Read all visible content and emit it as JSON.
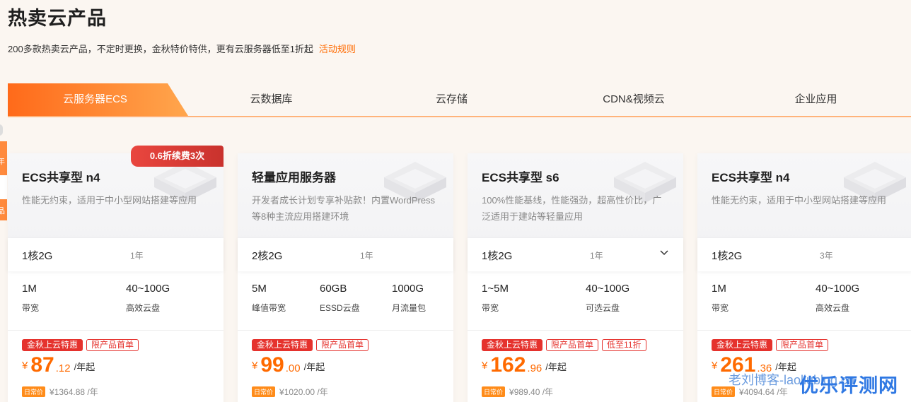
{
  "page": {
    "title": "热卖云产品",
    "subtitle": "200多款热卖云产品，不定时更换，金秋特价特供，更有云服务器低至1折起",
    "rules_link": "活动规则"
  },
  "tabs": [
    {
      "label": "云服务器ECS",
      "active": true
    },
    {
      "label": "云数据库",
      "active": false
    },
    {
      "label": "云存储",
      "active": false
    },
    {
      "label": "CDN&视频云",
      "active": false
    },
    {
      "label": "企业应用",
      "active": false
    }
  ],
  "side_widget": {
    "top_char": "年",
    "bottom_char": "品"
  },
  "cards": [
    {
      "name": "ECS共享型 n4",
      "badge": "0.6折续费3次",
      "desc": "性能无约束，适用于中小型网站搭建等应用",
      "config": {
        "spec": "1核2G",
        "period": "1年"
      },
      "specs": [
        {
          "value": "1M",
          "label": "带宽"
        },
        {
          "value": "40~100G",
          "label": "高效云盘"
        }
      ],
      "tags": [
        "金秋上云特惠",
        "限产品首单"
      ],
      "price": {
        "currency": "¥",
        "integer": "87",
        "decimal": ".12",
        "unit": "/年起"
      },
      "daily": {
        "badge": "日常价",
        "text": "¥1364.88 /年"
      }
    },
    {
      "name": "轻量应用服务器",
      "desc": "开发者成长计划专享补贴款！内置WordPress等8种主流应用搭建环境",
      "config": {
        "spec": "2核2G",
        "period": "1年"
      },
      "specs": [
        {
          "value": "5M",
          "label": "峰值带宽"
        },
        {
          "value": "60GB",
          "label": "ESSD云盘"
        },
        {
          "value": "1000G",
          "label": "月流量包"
        }
      ],
      "tags": [
        "金秋上云特惠",
        "限产品首单"
      ],
      "price": {
        "currency": "¥",
        "integer": "99",
        "decimal": ".00",
        "unit": "/年起"
      },
      "daily": {
        "badge": "日常价",
        "text": "¥1020.00 /年"
      }
    },
    {
      "name": "ECS共享型 s6",
      "desc": "100%性能基线，性能强劲，超高性价比，广泛适用于建站等轻量应用",
      "config": {
        "spec": "1核2G",
        "period": "1年"
      },
      "specs": [
        {
          "value": "1~5M",
          "label": "带宽"
        },
        {
          "value": "40~100G",
          "label": "可选云盘"
        }
      ],
      "tags": [
        "金秋上云特惠",
        "限产品首单",
        "低至11折"
      ],
      "price": {
        "currency": "¥",
        "integer": "162",
        "decimal": ".96",
        "unit": "/年起"
      },
      "daily": {
        "badge": "日常价",
        "text": "¥989.40 /年"
      }
    },
    {
      "name": "ECS共享型 n4",
      "desc": "性能无约束，适用于中小型网站搭建等应用",
      "config": {
        "spec": "1核2G",
        "period": "3年"
      },
      "specs": [
        {
          "value": "1M",
          "label": "带宽"
        },
        {
          "value": "40~100G",
          "label": "高效云盘"
        }
      ],
      "tags": [
        "金秋上云特惠",
        "限产品首单"
      ],
      "price": {
        "currency": "¥",
        "integer": "261",
        "decimal": ".36",
        "unit": "/年起"
      },
      "daily": {
        "badge": "日常价",
        "text": "¥4094.64 /年"
      }
    }
  ],
  "watermarks": {
    "blog": "老刘博客-laoliublog.cn",
    "site": "优乐评测网"
  }
}
